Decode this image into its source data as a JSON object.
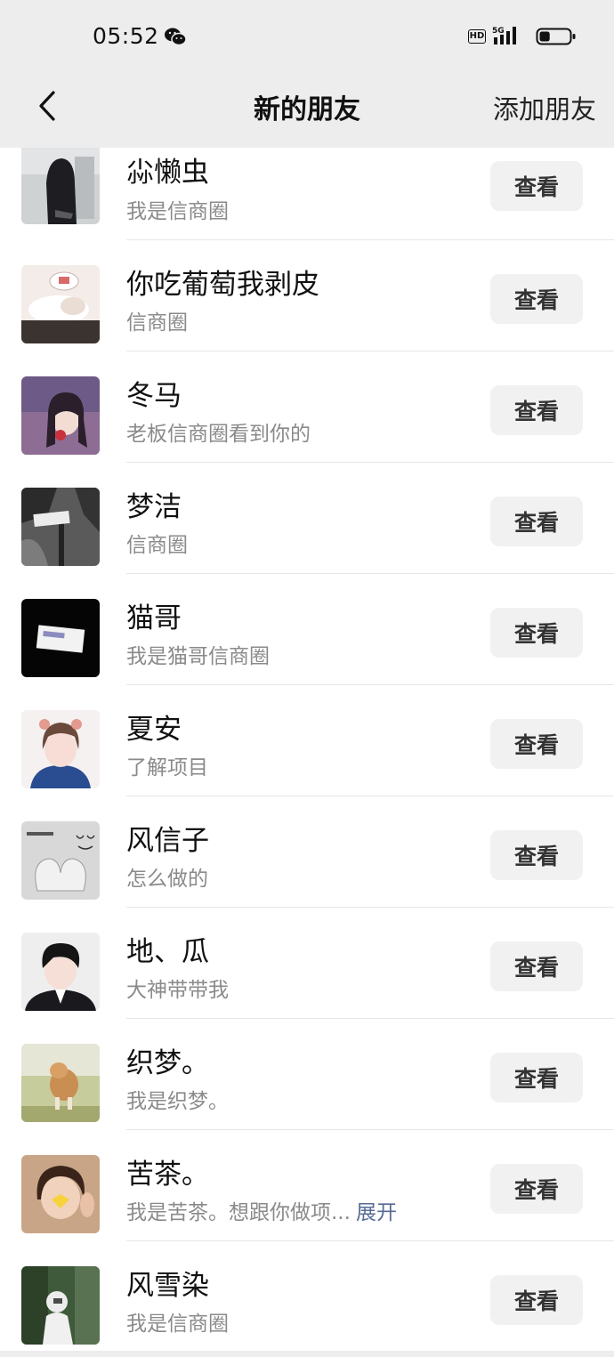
{
  "status_bar": {
    "time": "05:52",
    "hd": "HD",
    "network": "5G",
    "icons": [
      "wechat-icon",
      "signal-icon",
      "battery-icon"
    ],
    "battery_level": 0.35
  },
  "nav": {
    "back_icon": "chevron-left-icon",
    "title": "新的朋友",
    "action": "添加朋友"
  },
  "friends": [
    {
      "name": "尛懒虫",
      "desc": "我是信商圈",
      "button": "查看"
    },
    {
      "name": "你吃葡萄我剥皮",
      "desc": "信商圈",
      "button": "查看"
    },
    {
      "name": "冬马",
      "desc": "老板信商圈看到你的",
      "button": "查看"
    },
    {
      "name": "梦洁",
      "desc": "信商圈",
      "button": "查看"
    },
    {
      "name": "猫哥",
      "desc": "我是猫哥信商圈",
      "button": "查看"
    },
    {
      "name": "夏安",
      "desc": "了解项目",
      "button": "查看"
    },
    {
      "name": "风信子",
      "desc": "怎么做的",
      "button": "查看"
    },
    {
      "name": "地、瓜",
      "desc": "大神带带我",
      "button": "查看"
    },
    {
      "name": "织梦。",
      "desc": "我是织梦。",
      "button": "查看"
    },
    {
      "name": "苦茶。",
      "desc": "我是苦茶。想跟你做项...",
      "expand": "展开",
      "button": "查看"
    },
    {
      "name": "风雪染",
      "desc": "我是信商圈",
      "button": "查看"
    }
  ],
  "colors": {
    "header_bg": "#ededed",
    "link": "#576b95",
    "button_bg": "#f1f1f1",
    "secondary_text": "#8a8a8a"
  }
}
